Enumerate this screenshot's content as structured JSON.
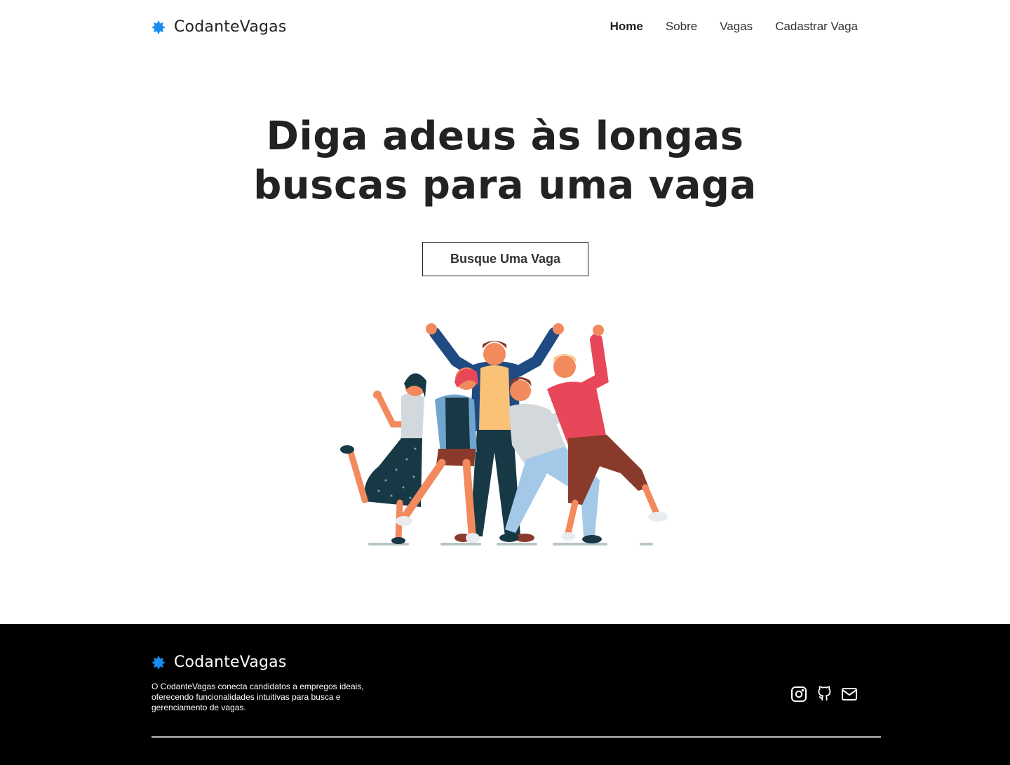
{
  "header": {
    "brand": "CodanteVagas",
    "brand_color": "#1a8cf0",
    "nav": [
      {
        "label": "Home",
        "active": true
      },
      {
        "label": "Sobre",
        "active": false
      },
      {
        "label": "Vagas",
        "active": false
      },
      {
        "label": "Cadastrar Vaga",
        "active": false
      }
    ]
  },
  "hero": {
    "title_line1": "Diga adeus às longas",
    "title_line2": "buscas para uma vaga",
    "cta_label": "Busque Uma Vaga"
  },
  "footer": {
    "brand": "CodanteVagas",
    "description": "O CodanteVagas conecta candidatos a empregos ideais, oferecendo funcionalidades intuitivas para busca e gerenciamento de vagas.",
    "socials": [
      "instagram-icon",
      "github-icon",
      "mail-icon"
    ]
  }
}
